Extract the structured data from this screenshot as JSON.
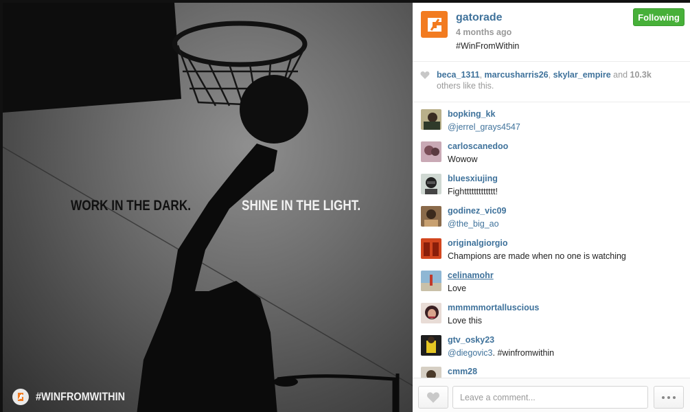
{
  "photo": {
    "tagline_dark": "WORK IN THE DARK.",
    "tagline_light": "SHINE IN THE LIGHT.",
    "hashtag_overlay": "#WINFROMWITHIN"
  },
  "post": {
    "username": "gatorade",
    "age": "4 months ago",
    "caption": "#WinFromWithin",
    "follow_label": "Following",
    "brand_color": "#f27b20",
    "follow_color": "#47b039",
    "link_color": "#3f729b"
  },
  "likes": {
    "users": [
      "beca_1311",
      "marcusharris26",
      "skylar_empire"
    ],
    "and_text": "and",
    "count": "10.3k",
    "suffix": "others like this."
  },
  "comments": [
    {
      "user": "bopking_kk",
      "text": "@jerrel_grays4547",
      "mention": true
    },
    {
      "user": "carloscanedoo",
      "text": "Wowow",
      "mention": false
    },
    {
      "user": "bluesxiujing",
      "text": "Fighttttttttttttt!",
      "mention": false
    },
    {
      "user": "godinez_vic09",
      "text": "@the_big_ao",
      "mention": true
    },
    {
      "user": "originalgiorgio",
      "text": "Champions are made when no one is watching",
      "mention": false
    },
    {
      "user": "celinamohr",
      "text": "Love",
      "mention": false
    },
    {
      "user": "mmmmmortalluscious",
      "text": "Love this",
      "mention": false
    },
    {
      "user": "gtv_osky23",
      "text_mention": "@diegovic3",
      "text_rest": ". #winfromwithin",
      "mention": true
    },
    {
      "user": "cmm28",
      "text": "",
      "mention": false
    }
  ],
  "footer": {
    "comment_placeholder": "Leave a comment..."
  },
  "icons": {
    "heart": "heart-icon",
    "more": "more-options-icon",
    "brand": "gatorade-logo"
  }
}
